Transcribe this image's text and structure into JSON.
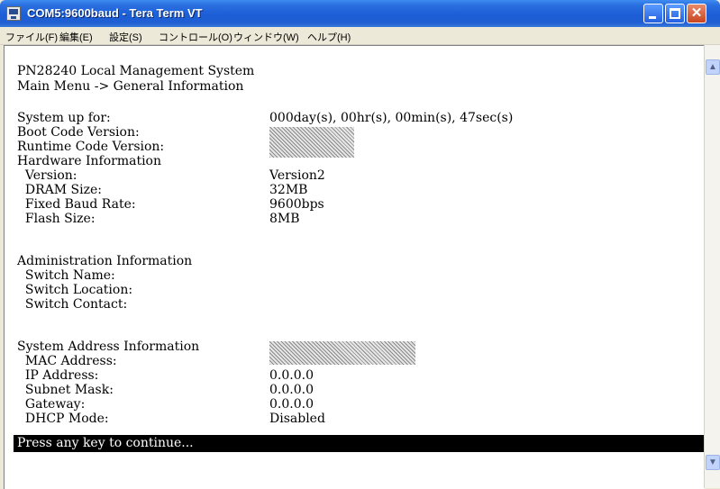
{
  "window": {
    "title": "COM5:9600baud - Tera Term VT",
    "close_glyph": "✕"
  },
  "menu": [
    {
      "label": "ファイル(F)"
    },
    {
      "label": "編集(E)"
    },
    {
      "label": "設定(S)"
    },
    {
      "label": "コントロール(O)"
    },
    {
      "label": "ウィンドウ(W)"
    },
    {
      "label": "ヘルプ(H)"
    }
  ],
  "terminal": {
    "header1": "PN28240 Local Management System",
    "header2": "Main Menu -> General Information",
    "rows": {
      "uptime": {
        "label": "System up for:",
        "value": "000day(s), 00hr(s), 00min(s), 47sec(s)"
      },
      "boot": {
        "label": "Boot Code Version:"
      },
      "runtime": {
        "label": "Runtime Code Version:"
      },
      "hw_heading": {
        "label": "Hardware Information"
      },
      "version": {
        "label": "  Version:",
        "value": "Version2"
      },
      "dram": {
        "label": "  DRAM Size:",
        "value": "32MB"
      },
      "baud": {
        "label": "  Fixed Baud Rate:",
        "value": "9600bps"
      },
      "flash": {
        "label": "  Flash Size:",
        "value": "8MB"
      },
      "admin_heading": {
        "label": "Administration Information"
      },
      "switch_name": {
        "label": "  Switch Name:"
      },
      "switch_location": {
        "label": "  Switch Location:"
      },
      "switch_contact": {
        "label": "  Switch Contact:"
      },
      "addr_heading": {
        "label": "System Address Information"
      },
      "mac": {
        "label": "  MAC Address:"
      },
      "ip": {
        "label": "  IP Address:",
        "value": "0.0.0.0"
      },
      "subnet": {
        "label": "  Subnet Mask:",
        "value": "0.0.0.0"
      },
      "gateway": {
        "label": "  Gateway:",
        "value": "0.0.0.0"
      },
      "dhcp": {
        "label": "  DHCP Mode:",
        "value": "Disabled"
      }
    },
    "prompt": "Press any key to continue..."
  },
  "scrollbar": {
    "up_glyph": "▲",
    "down_glyph": "▼"
  }
}
